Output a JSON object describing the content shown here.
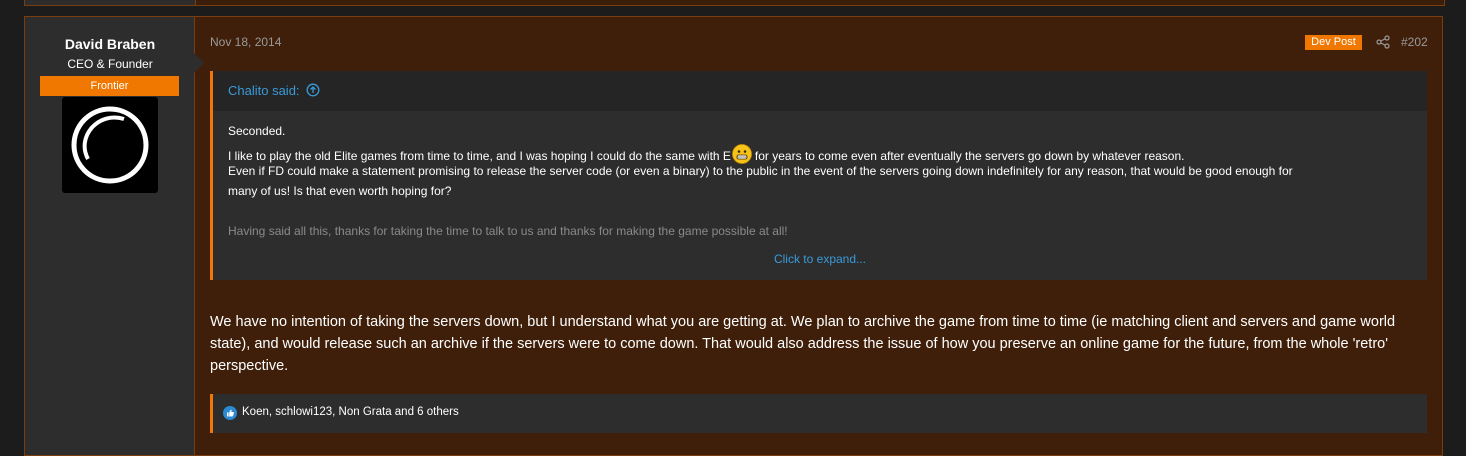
{
  "post": {
    "author": {
      "name": "David Braben",
      "title": "CEO & Founder",
      "banner": "Frontier",
      "avatar_icon": "frontier-logo-icon"
    },
    "date": "Nov 18, 2014",
    "badge": "Dev Post",
    "share_icon": "share-icon",
    "number": "#202",
    "quote": {
      "author": "Chalito said:",
      "jump_icon": "arrow-up-circle-icon",
      "lines": [
        "Seconded.",
        "I like to play the old Elite games from time to time, and I was hoping I could do the same with E",
        "for years to come even after eventually the servers go down by whatever reason.",
        "Even if FD could make a statement promising to release the server code (or even a binary) to the public in the event of the servers going down indefinitely for any reason, that would be good enough for",
        "many of us! Is that even worth hoping for?",
        "Having said all this, thanks for taking the time to talk to us and thanks for making the game possible at all!"
      ],
      "smiley_icon": "grin-smiley-icon",
      "expand": "Click to expand..."
    },
    "message": "We have no intention of taking the servers down, but I understand what you are getting at. We plan to archive the game from time to time (ie matching client and servers and game world state), and would release such an archive if the servers were to come down. That would also address the issue of how you preserve an online game for the future, from the whole 'retro' perspective.",
    "reactions": {
      "icon": "thumbs-up-icon",
      "text": "Koen, schlowi123, Non Grata and 6 others"
    }
  },
  "colors": {
    "accent": "#f07800",
    "link": "#3a9ad9",
    "post_bg": "#3f1f0a",
    "border": "#7a3d0e",
    "panel": "#2d2d2d"
  }
}
